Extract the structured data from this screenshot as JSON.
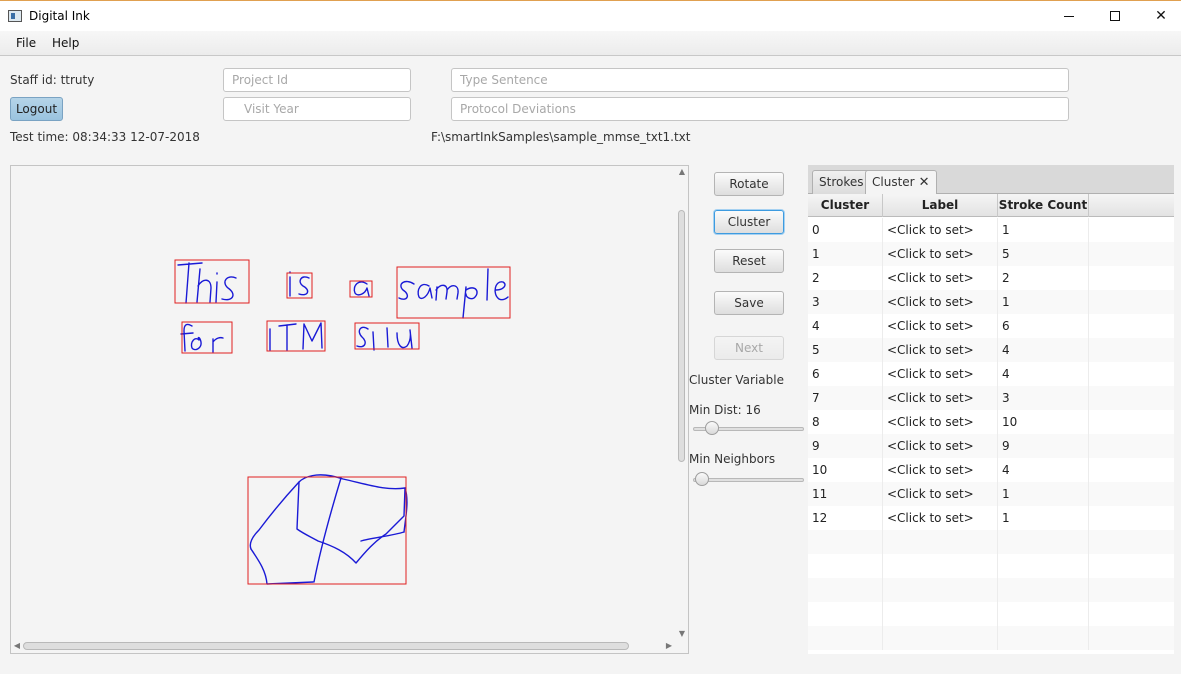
{
  "window": {
    "title": "Digital Ink"
  },
  "menu": {
    "file": "File",
    "help": "Help"
  },
  "info": {
    "staff_id": "Staff id: ttruty",
    "logout": "Logout",
    "test_time": "Test time: 08:34:33 12-07-2018",
    "file_path": "F:\\smartInkSamples\\sample_mmse_txt1.txt"
  },
  "fields": {
    "project_id": {
      "placeholder": "Project Id",
      "value": ""
    },
    "visit_year": {
      "placeholder": "Visit Year",
      "value": ""
    },
    "type_sentence": {
      "placeholder": "Type Sentence",
      "value": ""
    },
    "protocol_deviations": {
      "placeholder": "Protocol Deviations",
      "value": ""
    }
  },
  "controls": {
    "rotate": "Rotate",
    "cluster": "Cluster",
    "reset": "Reset",
    "save": "Save",
    "next": "Next",
    "cluster_variable": "Cluster  Variable",
    "min_dist": "Min Dist: 16",
    "min_dist_level": 0.1,
    "min_neighbors": "Min Neighbors",
    "min_neighbors_level": 0.0
  },
  "tabs": {
    "strokes": "Strokes",
    "cluster": "Cluster"
  },
  "table": {
    "headers": [
      "Cluster",
      "Label",
      "Stroke Count",
      ""
    ],
    "rows": [
      {
        "cluster": "0",
        "label": "<Click to set>",
        "count": "1"
      },
      {
        "cluster": "1",
        "label": "<Click to set>",
        "count": "5"
      },
      {
        "cluster": "2",
        "label": "<Click to set>",
        "count": "2"
      },
      {
        "cluster": "3",
        "label": "<Click to set>",
        "count": "1"
      },
      {
        "cluster": "4",
        "label": "<Click to set>",
        "count": "6"
      },
      {
        "cluster": "5",
        "label": "<Click to set>",
        "count": "4"
      },
      {
        "cluster": "6",
        "label": "<Click to set>",
        "count": "4"
      },
      {
        "cluster": "7",
        "label": "<Click to set>",
        "count": "3"
      },
      {
        "cluster": "8",
        "label": "<Click to set>",
        "count": "10"
      },
      {
        "cluster": "9",
        "label": "<Click to set>",
        "count": "9"
      },
      {
        "cluster": "10",
        "label": "<Click to set>",
        "count": "4"
      },
      {
        "cluster": "11",
        "label": "<Click to set>",
        "count": "1"
      },
      {
        "cluster": "12",
        "label": "<Click to set>",
        "count": "1"
      }
    ]
  },
  "colors": {
    "ink": "#1a1ad6",
    "box": "#e02020",
    "accent": "#3d9be0"
  }
}
